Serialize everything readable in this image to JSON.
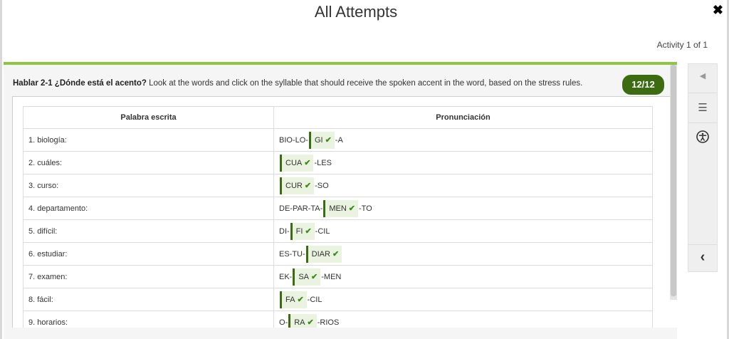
{
  "header": {
    "title": "All Attempts",
    "close_icon": "✖",
    "activity_counter": "Activity 1 of 1"
  },
  "activity": {
    "title_bold": "Hablar 2-1 ¿Dónde está el acento?",
    "instructions": "Look at the words and click on the syllable that should receive the spoken accent in the word, based on the stress rules.",
    "score": "12/12"
  },
  "table": {
    "headers": [
      "Palabra escrita",
      "Pronunciación"
    ],
    "rows": [
      {
        "word": "1. biología:",
        "pre": "BIO-LO-",
        "stressed": "GI",
        "post": "-A"
      },
      {
        "word": "2. cuáles:",
        "pre": "",
        "stressed": "CUA",
        "post": "-LES"
      },
      {
        "word": "3. curso:",
        "pre": "",
        "stressed": "CUR",
        "post": "-SO"
      },
      {
        "word": "4. departamento:",
        "pre": "DE-PAR-TA-",
        "stressed": "MEN",
        "post": "-TO"
      },
      {
        "word": "5. difícil:",
        "pre": "DI-",
        "stressed": "FI",
        "post": "-CIL"
      },
      {
        "word": "6. estudiar:",
        "pre": "ES-TU-",
        "stressed": "DIAR",
        "post": ""
      },
      {
        "word": "7. examen:",
        "pre": "EK-",
        "stressed": "SA",
        "post": "-MEN"
      },
      {
        "word": "8. fácil:",
        "pre": "",
        "stressed": "FA",
        "post": "-CIL"
      },
      {
        "word": "9. horarios:",
        "pre": "O-",
        "stressed": "RA",
        "post": "-RIOS"
      }
    ]
  },
  "sidebar": {
    "prev_icon": "◀",
    "menu_icon": "☰",
    "accessibility_icon": "accessibility",
    "collapse_icon": "‹"
  },
  "colors": {
    "accent_green": "#8dc63f",
    "dark_green": "#3d6b11",
    "check_green": "#3d8a1a"
  }
}
